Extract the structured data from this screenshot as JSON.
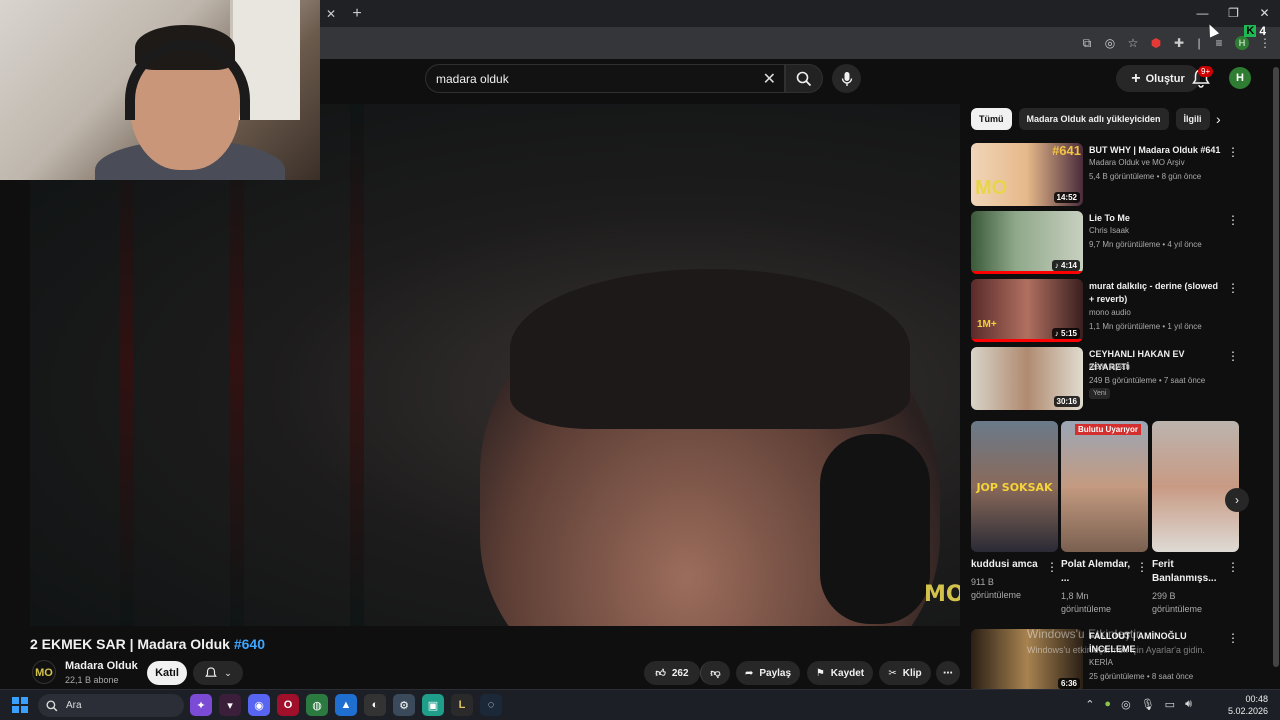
{
  "browser": {
    "extension_count": "4",
    "extension_letter": "K",
    "profile_initial": "H"
  },
  "header": {
    "search_value": "madara olduk",
    "create_label": "Oluştur",
    "notifications_badge": "9+",
    "avatar_initial": "H"
  },
  "player": {
    "logo": "MO"
  },
  "video": {
    "title": "2 EKMEK SAR | Madara Olduk",
    "hashtag": "#640",
    "channel_name": "Madara Olduk",
    "channel_avatar": "MO",
    "subscribers": "22,1 B abone",
    "join_label": "Katıl",
    "likes": "262",
    "share_label": "Paylaş",
    "save_label": "Kaydet",
    "clip_label": "Klip"
  },
  "chips": [
    "Tümü",
    "Madara Olduk adlı yükleyiciden",
    "İlgili"
  ],
  "recommendations": [
    {
      "title": "BUT WHY | Madara Olduk #641",
      "channel": "Madara Olduk ve MO Arşiv",
      "meta": "5,4 B görüntüleme • 8 gün önce",
      "duration": "14:52",
      "badge": "",
      "thumb_text": "#641"
    },
    {
      "title": "Lie To Me",
      "channel": "Chris Isaak",
      "meta": "9,7 Mn görüntüleme • 4 yıl önce",
      "duration": "♪ 4:14",
      "badge": "",
      "thumb_text": ""
    },
    {
      "title": "murat dalkılıç - derine (slowed + reverb)",
      "channel": "mono audio",
      "meta": "1,1 Mn görüntüleme • 1 yıl önce",
      "duration": "♪ 5:15",
      "badge": "",
      "thumb_text": "1M+"
    },
    {
      "title": "CEYHANLI HAKAN EV ZİYARETİ",
      "channel": "testo taylan",
      "meta": "249 B görüntüleme • 7 saat önce",
      "duration": "30:16",
      "badge": "Yeni",
      "thumb_text": ""
    },
    {
      "title": "FALLOUT | AMİNOĞLU İNCELEME",
      "channel": "KERİA",
      "meta": "25 görüntüleme • 8 saat önce",
      "duration": "6:36",
      "badge": "",
      "thumb_text": ""
    }
  ],
  "shorts": [
    {
      "title": "kuddusi amca",
      "views": "911 B görüntüleme",
      "overlay": "JOP SOKSAK"
    },
    {
      "title": "Polat Alemdar, ...",
      "views": "1,8 Mn görüntüleme",
      "overlay": "Bulutu Uyarıyor"
    },
    {
      "title": "Ferit Banlanmışs...",
      "views": "299 B görüntüleme",
      "overlay": ""
    }
  ],
  "watermark": {
    "line1": "Windows'u Etkinleştir",
    "line2": "Windows'u etkinleştirmek için Ayarlar'a gidin."
  },
  "taskbar": {
    "search_placeholder": "Ara",
    "time": "00:48",
    "date": "5.02.2026"
  },
  "colors": {
    "background": "#0f0f0f",
    "accent_red": "#ff0000",
    "link_blue": "#3ea6ff",
    "logo_yellow": "#d4c34a"
  }
}
